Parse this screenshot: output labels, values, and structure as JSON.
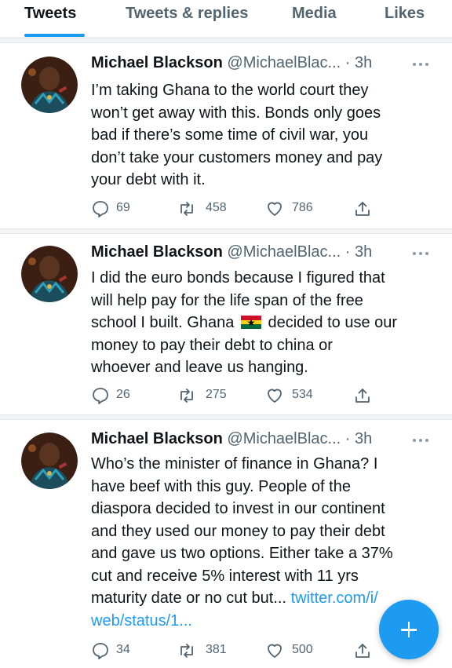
{
  "tabs": [
    {
      "label": "Tweets",
      "active": true
    },
    {
      "label": "Tweets & replies",
      "active": false
    },
    {
      "label": "Media",
      "active": false
    },
    {
      "label": "Likes",
      "active": false
    }
  ],
  "tweets": [
    {
      "name": "Michael Blackson",
      "handle": "@MichaelBlac...",
      "time": "· 3h",
      "lines": [
        "I’m taking Ghana to the world court they",
        "won’t get away with this. Bonds only goes",
        "bad if there’s some time of civil war, you",
        "don’t take your customers money and pay",
        "your debt with it."
      ],
      "replies": "69",
      "retweets": "458",
      "likes": "786"
    },
    {
      "name": "Michael Blackson",
      "handle": "@MichaelBlac...",
      "time": "· 3h",
      "lines": [
        "I did the euro bonds because I figured that",
        "will help pay for the life span of the free",
        "school I built. Ghana",
        "money to pay their debt to china or",
        "whoever and leave us hanging."
      ],
      "line3_after_flag": "decided to use our",
      "flag_icon": "ghana-flag-icon",
      "replies": "26",
      "retweets": "275",
      "likes": "534"
    },
    {
      "name": "Michael Blackson",
      "handle": "@MichaelBlac...",
      "time": "· 3h",
      "lines": [
        "Who’s the minister of finance in Ghana? I",
        "have beef with this guy. People of the",
        "diaspora decided to invest in our continent",
        "and they used our money to pay their debt",
        "and gave us two options. Either take a 37%",
        "cut and receive 5% interest with 11 yrs",
        "maturity date or no cut but..."
      ],
      "link_part1": "twitter.com/i/",
      "link_part2": "web/status/1...",
      "replies": "34",
      "retweets": "381",
      "likes": "500"
    }
  ],
  "colors": {
    "accent": "#1d9bf0",
    "text": "#0f1419",
    "secondary": "#536471"
  },
  "icons": {
    "reply": "reply-icon",
    "retweet": "retweet-icon",
    "like": "heart-icon",
    "share": "share-icon",
    "more": "more-icon",
    "compose": "plus-icon"
  }
}
